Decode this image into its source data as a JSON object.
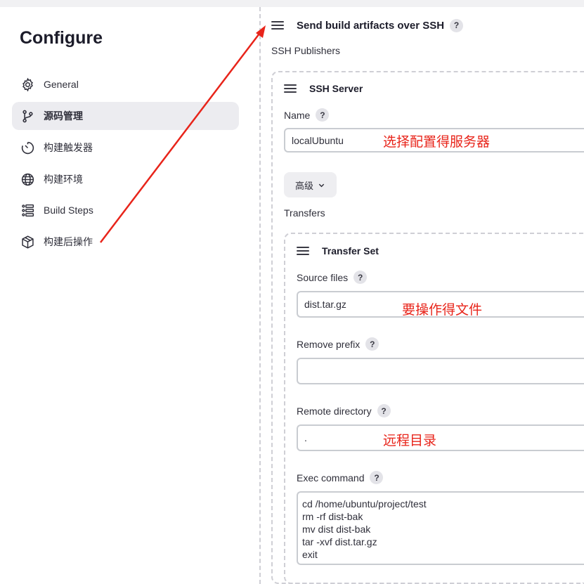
{
  "sidebar": {
    "title": "Configure",
    "items": [
      {
        "label": "General",
        "icon": "gear-icon",
        "active": false
      },
      {
        "label": "源码管理",
        "icon": "branch-icon",
        "active": true
      },
      {
        "label": "构建触发器",
        "icon": "timer-icon",
        "active": false
      },
      {
        "label": "构建环境",
        "icon": "globe-icon",
        "active": false
      },
      {
        "label": "Build Steps",
        "icon": "list-icon",
        "active": false
      },
      {
        "label": "构建后操作",
        "icon": "package-icon",
        "active": false
      }
    ]
  },
  "section": {
    "title": "Send build artifacts over SSH",
    "help": "?",
    "publishers_label": "SSH Publishers"
  },
  "server": {
    "title": "SSH Server",
    "name_label": "Name",
    "name_value": "localUbuntu",
    "name_annotation": "选择配置得服务器",
    "advanced_label": "高级",
    "transfers_label": "Transfers"
  },
  "transfer": {
    "title": "Transfer Set",
    "source_label": "Source files",
    "source_value": "dist.tar.gz",
    "source_annotation": "要操作得文件",
    "prefix_label": "Remove prefix",
    "prefix_value": "",
    "remote_label": "Remote directory",
    "remote_value": ".",
    "remote_annotation": "远程目录",
    "exec_label": "Exec command",
    "exec_value": "cd /home/ubuntu/project/test\nrm -rf dist-bak\nmv dist dist-bak\ntar -xvf dist.tar.gz\nexit"
  },
  "colors": {
    "annotation": "#e8241a",
    "active_nav_bg": "#ececf0"
  }
}
